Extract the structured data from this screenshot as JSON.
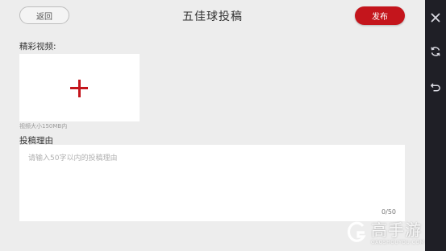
{
  "header": {
    "back_label": "返回",
    "title": "五佳球投稿",
    "publish_label": "发布"
  },
  "video": {
    "label": "精彩视频:",
    "size_hint": "视频大小150MB内",
    "upload_icon": "plus-icon"
  },
  "reason": {
    "label": "投稿理由",
    "placeholder": "请输入50字以内的投稿理由",
    "value": "",
    "counter": "0/50"
  },
  "side_bar": {
    "buttons": [
      "close-icon",
      "refresh-icon",
      "undo-icon"
    ]
  },
  "watermark": {
    "brand": "高手游",
    "domain": "GAOSHOUYOU.COM"
  },
  "colors": {
    "accent": "#c4151c",
    "background": "#ededed",
    "side_bar": "#1f1f26"
  }
}
